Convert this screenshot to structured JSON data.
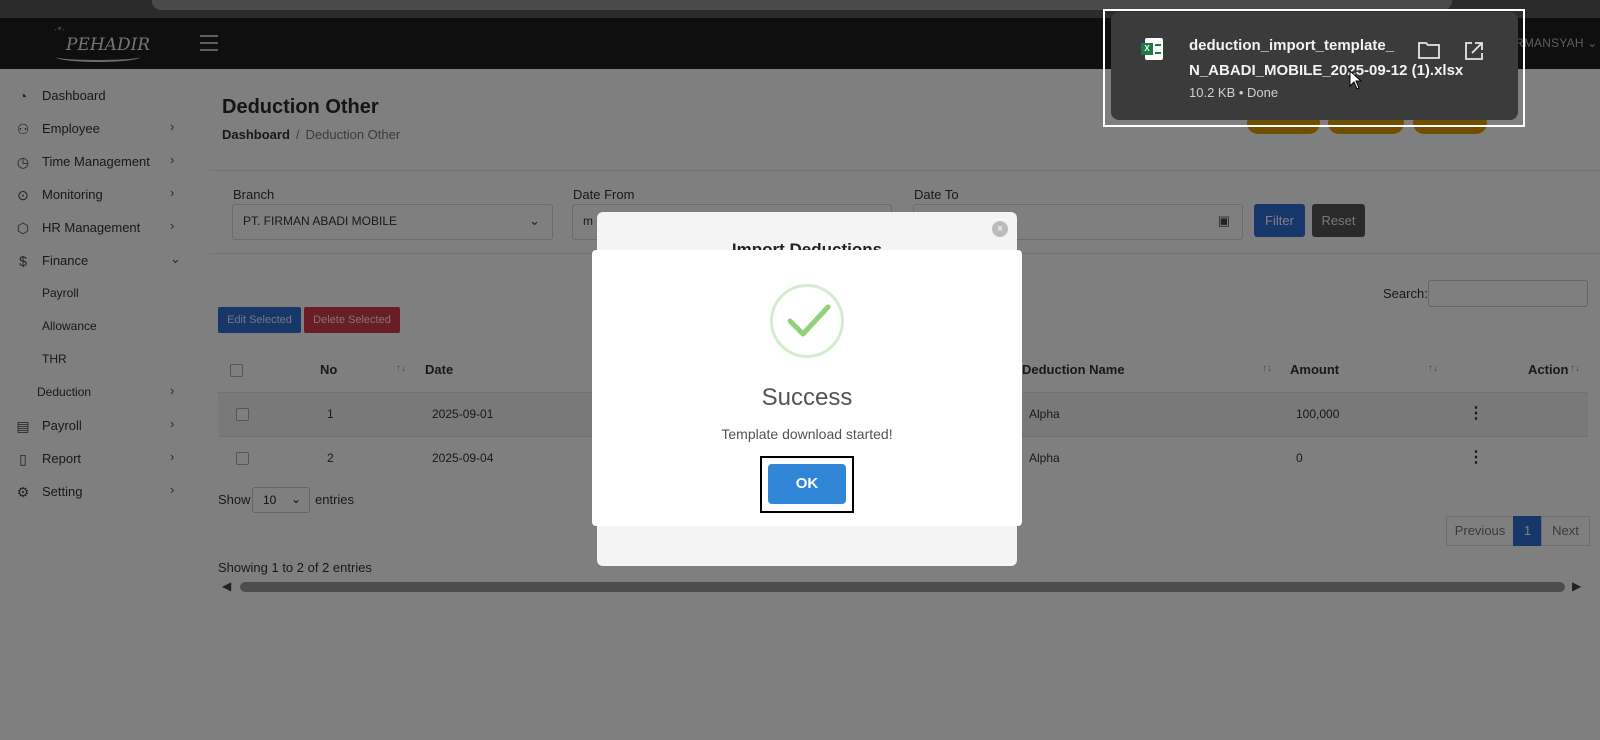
{
  "navbar": {
    "logo_text": "PEHADIR",
    "user_name": "RMANSYAH"
  },
  "sidebar": {
    "items": [
      {
        "label": "Dashboard",
        "icon": "gauge-icon"
      },
      {
        "label": "Employee",
        "icon": "users-icon"
      },
      {
        "label": "Time Management",
        "icon": "clock-icon"
      },
      {
        "label": "Monitoring",
        "icon": "map-pin-icon"
      },
      {
        "label": "HR Management",
        "icon": "box-icon"
      },
      {
        "label": "Finance",
        "icon": "dollar-icon"
      },
      {
        "label": "Payroll"
      },
      {
        "label": "Allowance"
      },
      {
        "label": "THR"
      },
      {
        "label": "Deduction"
      },
      {
        "label": "Payroll",
        "icon": "calculator-icon"
      },
      {
        "label": "Report",
        "icon": "file-icon"
      },
      {
        "label": "Setting",
        "icon": "gear-icon"
      }
    ]
  },
  "page": {
    "title": "Deduction Other",
    "breadcrumb_home": "Dashboard",
    "breadcrumb_sep": "/",
    "breadcrumb_current": "Deduction Other"
  },
  "filter": {
    "branch_label": "Branch",
    "branch_value": "PT. FIRMAN ABADI MOBILE",
    "date_from_label": "Date From",
    "date_from_value": "m",
    "date_to_label": "Date To",
    "filter_button": "Filter",
    "reset_button": "Reset"
  },
  "table": {
    "search_label": "Search:",
    "edit_selected": "Edit Selected",
    "delete_selected": "Delete Selected",
    "headers": {
      "no": "No",
      "date": "Date",
      "deduction_name": "Deduction Name",
      "amount": "Amount",
      "action": "Action"
    },
    "rows": [
      {
        "no": "1",
        "date": "2025-09-01",
        "deduction_name": "Alpha",
        "amount": "100,000"
      },
      {
        "no": "2",
        "date": "2025-09-04",
        "deduction_name": "Alpha",
        "amount": "0"
      }
    ],
    "show_label": "Show",
    "entries_value": "10",
    "entries_label": "entries",
    "showing_info": "Showing 1 to 2 of 2 entries",
    "pager_prev": "Previous",
    "pager_page": "1",
    "pager_next": "Next"
  },
  "import_modal": {
    "title": "Import Deductions"
  },
  "success_dialog": {
    "title": "Success",
    "message": "Template download started!",
    "ok_label": "OK"
  },
  "download": {
    "file_name_line1": "deduction_import_template_",
    "file_name_line2": "N_ABADI_MOBILE_2025-09-12 (1).xlsx",
    "meta": "10.2 KB • Done"
  },
  "colors": {
    "primary": "#2e6fd6",
    "danger": "#d33a4a",
    "success_check": "#8fd27a",
    "ok_button": "#3085d6"
  }
}
